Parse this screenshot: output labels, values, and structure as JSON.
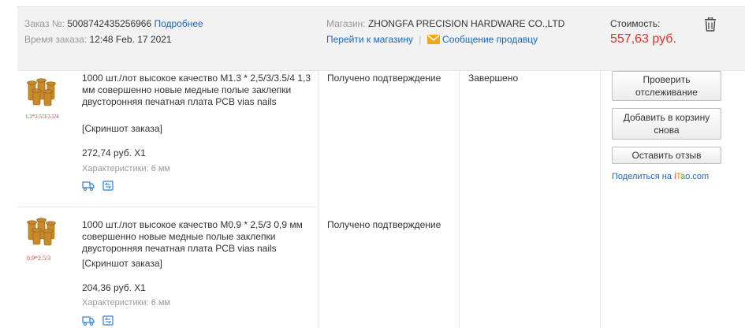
{
  "order": {
    "number_label": "Заказ №:",
    "number": "5008742435256966",
    "details_link": "Подробнее",
    "time_label": "Время заказа:",
    "time": "12:48 Feb. 17 2021",
    "shop_label": "Магазин:",
    "shop_name": "ZHONGFA PRECISION HARDWARE CO.,LTD",
    "goto_shop": "Перейти к магазину",
    "message_seller": "Сообщение продавцу",
    "cost_label": "Стоимость:",
    "cost_value": "557,63 руб."
  },
  "items": [
    {
      "thumb_caption": "1.3*2.5/3/3.5/4",
      "title": "1000 шт./лот высокое качество M1.3 * 2,5/3/3.5/4 1,3 мм совершенно новые медные полые заклепки двусторонняя печатная плата PCB vias nails",
      "snapshot": "[Скриншот заказа]",
      "price": "272,74 руб. X1",
      "props": "Характеристики: 6 мм",
      "status": "Получено подтверждение"
    },
    {
      "thumb_caption": "0.9*2.5/3",
      "title": "1000 шт./лот высокое качество M0.9 * 2,5/3 0,9 мм совершенно новые медные полые заклепки двусторонняя печатная плата PCB vias nails",
      "snapshot": "[Скриншот заказа]",
      "price": "204,36 руб. X1",
      "props": "Характеристики: 6 мм",
      "status": "Получено подтверждение"
    }
  ],
  "order_status": "Завершено",
  "actions": {
    "track": "Проверить отслеживание",
    "add_to_cart": "Добавить в корзину снова",
    "review": "Оставить отзыв",
    "share_prefix": "Поделиться на",
    "share_brand": [
      "i",
      "T",
      "a",
      "o",
      ".com"
    ]
  },
  "colors": {
    "price_red": "#e0312b",
    "link_blue": "#1d65b6",
    "header_bg": "#f2f2f2",
    "mail_icon": "#f3a712"
  },
  "icons": [
    "trash-icon",
    "mail-icon",
    "delivery-icon",
    "return-icon"
  ]
}
